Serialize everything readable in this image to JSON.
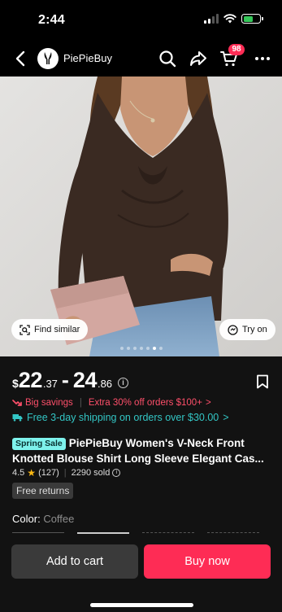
{
  "status_bar": {
    "time": "2:44"
  },
  "nav": {
    "store_name": "PiePieBuy",
    "cart_count": "98"
  },
  "image": {
    "find_similar": "Find similar",
    "try_on": "Try on",
    "carousel_total": 7,
    "carousel_active": 6
  },
  "price": {
    "currency": "$",
    "min_whole": "22",
    "min_cents": ".37",
    "separator": "-",
    "max_whole": "24",
    "max_cents": ".86",
    "info_glyph": "i"
  },
  "promo": {
    "big_savings": "Big savings",
    "extra_off": "Extra 30% off orders $100+",
    "chevron": ">",
    "shipping": "Free 3-day shipping on orders over $30.00",
    "shipping_chevron": ">"
  },
  "product": {
    "sale_badge": "Spring Sale",
    "title_line1": "PiePieBuy Women's V-Neck Front",
    "title_line2": "Knotted Blouse Shirt Long Sleeve Elegant Cas..."
  },
  "rating": {
    "score": "4.5",
    "reviews": "(127)",
    "sold": "2290 sold"
  },
  "badges": {
    "free_returns": "Free returns"
  },
  "color": {
    "label": "Color:",
    "value": "Coffee"
  },
  "actions": {
    "add_to_cart": "Add to cart",
    "buy_now": "Buy now"
  },
  "colors": {
    "accent": "#fe2c55",
    "savings": "#fe4f6a",
    "shipping": "#33c6c5",
    "badge": "#7ef2ec",
    "star": "#fdb913"
  }
}
